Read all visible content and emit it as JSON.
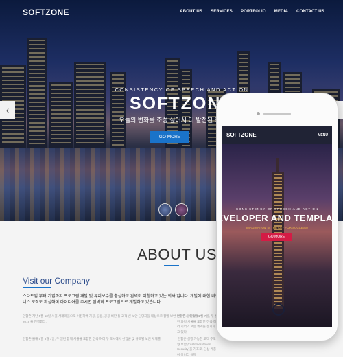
{
  "brand": {
    "logo": "SOFTZONE"
  },
  "nav": {
    "items": [
      "ABOUT US",
      "SERVICES",
      "PORTFOLIO",
      "MEDIA",
      "CONTACT US"
    ]
  },
  "hero": {
    "tagline": "CONSISTENCY OF SPEECH AND ACTION",
    "title": "SOFTZONE",
    "subtitle": "오늘의 변화를 조성 싶어서 더 발전된 회사로 거듭",
    "button_label": "GO MORE",
    "prev_icon": "chevron-left-icon",
    "next_icon": "chevron-right-icon"
  },
  "about": {
    "heading": "ABOUT US",
    "visit_heading": "Visit our Company",
    "description": "스타트업 부터 기업까지 프로그램 개발 및 유지보수를 충실하고 완벽히 이행하고 있는 회사 입니다. 개발에 대한 비즈니스 로직도 확실하며 아이디어를 주시면 완벽히 프로그램으로 개발하고 있습니다.",
    "para1": "만합존 지난 5월 13일 서울 서래마을으로 이전하여 가공, 공용, 공공 비판 등 고객 신 보안 담당자들 대상으로 활발 보안 컨퍼런스 '만합 ICP 2019'을 진행했다.",
    "para2": "만합존 올해 5월 3월 7일, 두 발전 과정 서울을 포함한 전국 여러 지역의 보안 체계를 설치하고 있다.",
    "para3": "만합존 올해 5월 3월 7일, 두 일련 함께 서울을 포함한 전국 여러 두 도시에서 산업군 및 규모별 보안 체계를",
    "para4": "'만합존 실행 가능한 고객 주도형 보안(Customer-driven Security)을 기조로, 단상 계층이 아니라 실제"
  },
  "phone": {
    "logo": "SOFTZONE",
    "menu_label": "MENU",
    "tagline": "CONSISTENCY OF SPEECH AND ACTION",
    "title": "DEVELOPER AND TEMPLATE",
    "subtitle": "IMAGINATION IS THE KEY FOR SUCCESS!",
    "button_label": "GO MORE"
  },
  "colors": {
    "accent_blue": "#1a73c9",
    "accent_red": "#d41c45"
  }
}
